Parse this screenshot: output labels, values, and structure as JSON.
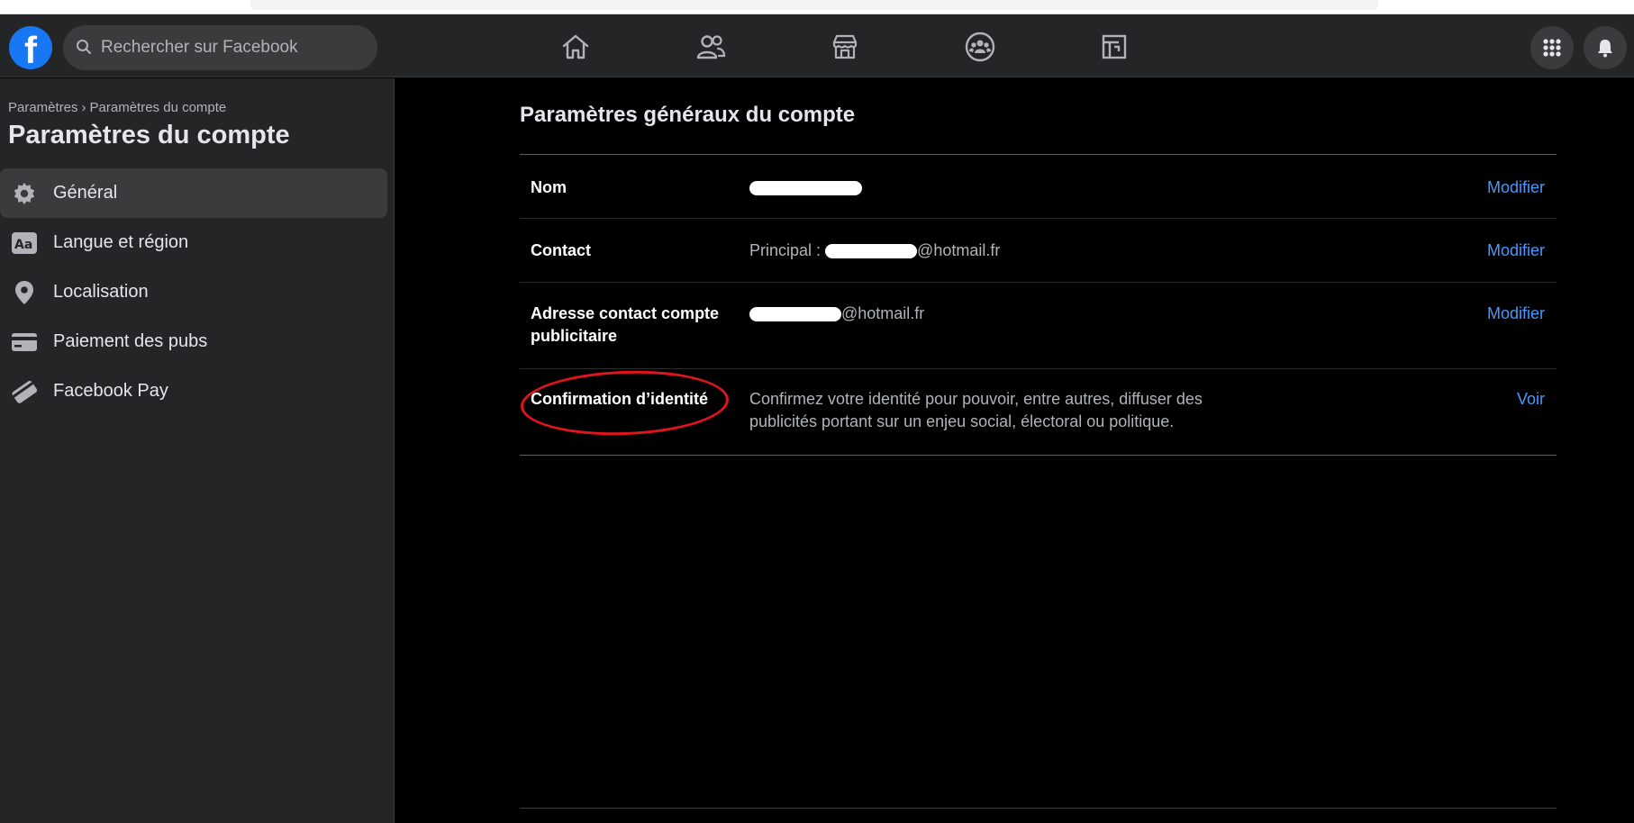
{
  "search": {
    "placeholder": "Rechercher sur Facebook"
  },
  "nav": {
    "icons": [
      "home-icon",
      "friends-icon",
      "marketplace-icon",
      "groups-icon",
      "gaming-icon"
    ],
    "right_icons": [
      "menu-grid-icon",
      "notifications-icon"
    ]
  },
  "sidebar": {
    "breadcrumb": [
      "Paramètres",
      "Paramètres du compte"
    ],
    "breadcrumb_sep": "›",
    "title": "Paramètres du compte",
    "items": [
      {
        "label": "Général",
        "icon": "gear-icon",
        "active": true
      },
      {
        "label": "Langue et région",
        "icon": "language-icon",
        "active": false
      },
      {
        "label": "Localisation",
        "icon": "location-pin-icon",
        "active": false
      },
      {
        "label": "Paiement des pubs",
        "icon": "credit-card-icon",
        "active": false
      },
      {
        "label": "Facebook Pay",
        "icon": "facebook-pay-icon",
        "active": false
      }
    ]
  },
  "main": {
    "title": "Paramètres généraux du compte",
    "rows": [
      {
        "label": "Nom",
        "value": "",
        "action": "Modifier"
      },
      {
        "label": "Contact",
        "value_prefix": "Principal : ",
        "value_suffix": "@hotmail.fr",
        "action": "Modifier"
      },
      {
        "label": "Adresse contact compte publicitaire",
        "value_suffix": "@hotmail.fr",
        "action": "Modifier"
      },
      {
        "label": "Confirmation d’identité",
        "value": "Confirmez votre identité pour pouvoir, entre autres, diffuser des publicités portant sur un enjeu social, électoral ou politique.",
        "action": "Voir"
      }
    ]
  },
  "colors": {
    "brand": "#1877f2",
    "link": "#4599ff",
    "annotation": "#e0141d",
    "surface": "#242526"
  }
}
